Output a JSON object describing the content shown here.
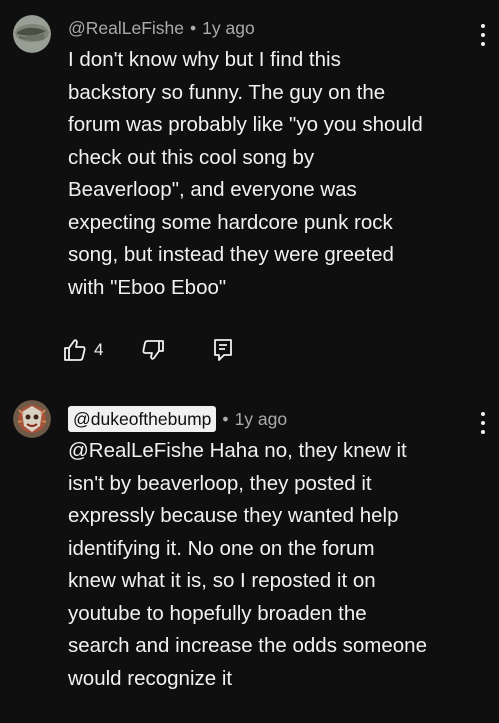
{
  "comments": [
    {
      "handle": "@RealLeFishe",
      "separator": "•",
      "time": "1y ago",
      "lines": [
        "I don't know why but I find this",
        "backstory so funny. The guy on the",
        "forum was probably like \"yo you should",
        "check out this cool song by",
        "Beaverloop\", and everyone was",
        "expecting some hardcore punk rock",
        "song, but instead they were greeted",
        "with \"Eboo Eboo\""
      ],
      "like_count": "4",
      "icons": {
        "like": "thumbs-up-icon",
        "dislike": "thumbs-down-icon",
        "reply": "reply-icon",
        "menu": "more-vertical-icon"
      }
    },
    {
      "handle": "@dukeofthebump",
      "separator": "•",
      "time": "1y ago",
      "lines": [
        "@RealLeFishe Haha no, they knew it",
        "isn't by beaverloop, they posted it",
        "expressly because they wanted help",
        "identifying it. No one on the forum",
        "knew what it is, so I reposted it on",
        "youtube to hopefully broaden the",
        "search and increase the odds someone",
        "would recognize it"
      ],
      "icons": {
        "menu": "more-vertical-icon"
      }
    }
  ],
  "colors": {
    "background": "#0f0f0f",
    "text": "#f1f1f1",
    "meta": "#aaaaaa"
  }
}
